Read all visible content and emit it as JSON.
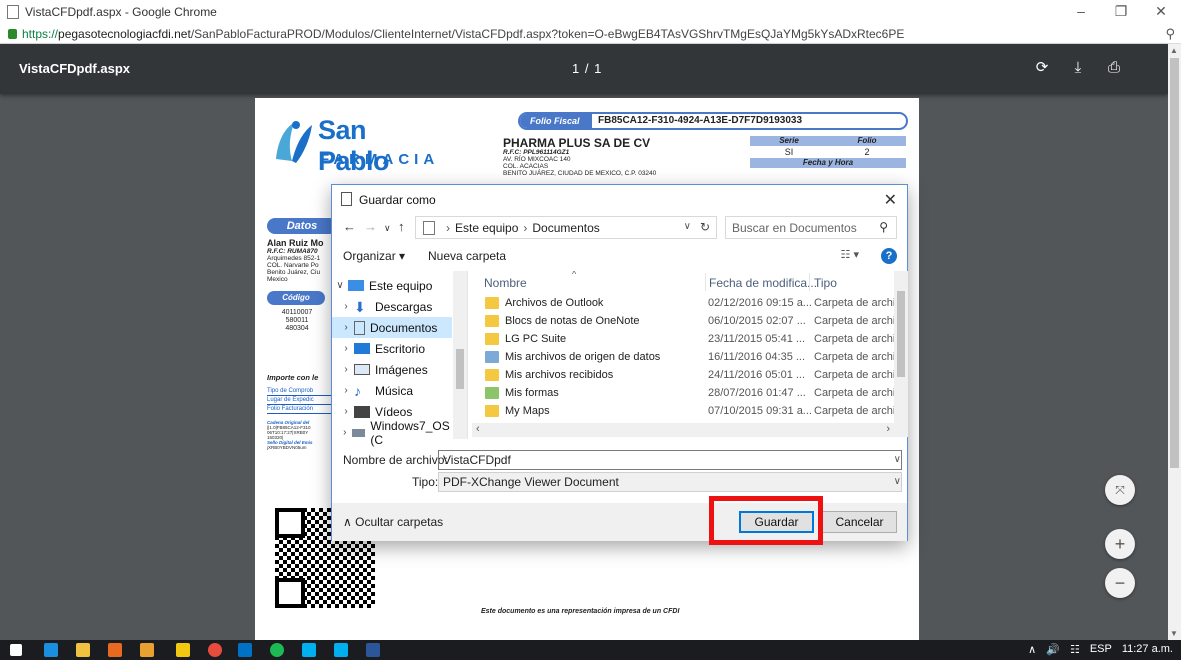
{
  "browser": {
    "tab_title": "VistaCFDpdf.aspx - Google Chrome",
    "url_scheme": "https://",
    "url_host": "pegasotecnologiacfdi.net",
    "url_path": "/SanPabloFacturaPROD/Modulos/ClienteInternet/VistaCFDpdf.aspx?token=O-eBwgEB4TAsVGShrvTMgEsQJaYMg5kYsADxRtec6PE"
  },
  "viewer": {
    "doc_title": "VistaCFDpdf.aspx",
    "page_indicator": "1 / 1"
  },
  "invoice": {
    "brand_line1": "San Pablo",
    "brand_line2": "FARMACIA",
    "folio_label": "Folio Fiscal",
    "folio_value": "FB85CA12-F310-4924-A13E-D7F7D9193033",
    "company": "PHARMA PLUS SA DE CV",
    "company_rfc": "R.F.C: PPL961114GZ1",
    "company_addr1": "AV. RÍO MIXCOAC 140",
    "company_addr2": "COL. ACACIAS",
    "company_addr3": "BENITO JUÁREZ, CIUDAD DE MEXICO, C.P. 03240",
    "serie_label": "Serie",
    "folio_col_label": "Folio",
    "serie_value": "SI",
    "folio_num": "2",
    "fecha_label": "Fecha y Hora",
    "datos_label": "Datos",
    "client_name": "Alan Ruiz Mo",
    "client_rfc": "R.F.C: RUMA870",
    "client_addr1": "Arquimedes 852-1",
    "client_addr2": "COL. Narvarte Po",
    "client_addr3": "Benito Juárez, Ciu",
    "client_addr4": "Mexico",
    "codigo_label": "Código",
    "codes": [
      "40110007",
      "580011",
      "480304"
    ],
    "importe_label": "Importe con le",
    "links": [
      "Tipo de Comprob",
      "Lugar de Expedic",
      "Folio Facturación"
    ],
    "cadena_lines": [
      "Cadena Original del",
      "||1.0|FB85CA12-F310",
      "06T10:17:27|XRB0Y",
      "150320|",
      "Sello Digital del Emis",
      "jXRB0YBDVN05um"
    ],
    "footer_note": "Este documento es una representación impresa de un CFDI"
  },
  "dialog": {
    "title": "Guardar como",
    "crumb_root": "Este equipo",
    "crumb_current": "Documentos",
    "search_placeholder": "Buscar en Documentos",
    "organize": "Organizar ▾",
    "new_folder": "Nueva carpeta",
    "columns": {
      "name": "Nombre",
      "date": "Fecha de modifica...",
      "type": "Tipo"
    },
    "tree": [
      {
        "label": "Este equipo"
      },
      {
        "label": "Descargas"
      },
      {
        "label": "Documentos"
      },
      {
        "label": "Escritorio"
      },
      {
        "label": "Imágenes"
      },
      {
        "label": "Música"
      },
      {
        "label": "Vídeos"
      },
      {
        "label": "Windows7_OS (C"
      }
    ],
    "files": [
      {
        "name": "Archivos de Outlook",
        "date": "02/12/2016 09:15 a...",
        "type": "Carpeta de archiv"
      },
      {
        "name": "Blocs de notas de OneNote",
        "date": "06/10/2015 02:07 ...",
        "type": "Carpeta de archiv"
      },
      {
        "name": "LG PC Suite",
        "date": "23/11/2015 05:41 ...",
        "type": "Carpeta de archiv"
      },
      {
        "name": "Mis archivos de origen de datos",
        "date": "16/11/2016 04:35 ...",
        "type": "Carpeta de archiv"
      },
      {
        "name": "Mis archivos recibidos",
        "date": "24/11/2016 05:01 ...",
        "type": "Carpeta de archiv"
      },
      {
        "name": "Mis formas",
        "date": "28/07/2016 01:47 ...",
        "type": "Carpeta de archiv"
      },
      {
        "name": "My Maps",
        "date": "07/10/2015 09:31 a...",
        "type": "Carpeta de archiv"
      }
    ],
    "filename_label": "Nombre de archivo:",
    "filename_value": "VistaCFDpdf",
    "type_label": "Tipo:",
    "type_value": "PDF-XChange Viewer Document",
    "hide_folders": "Ocultar carpetas",
    "save_label": "Guardar",
    "cancel_label": "Cancelar"
  },
  "taskbar": {
    "lang": "ESP",
    "time": "11:27 a.m."
  },
  "colors": {
    "accent": "#4a78c9",
    "highlight": "#ee1111",
    "viewer_bg": "#525659"
  }
}
